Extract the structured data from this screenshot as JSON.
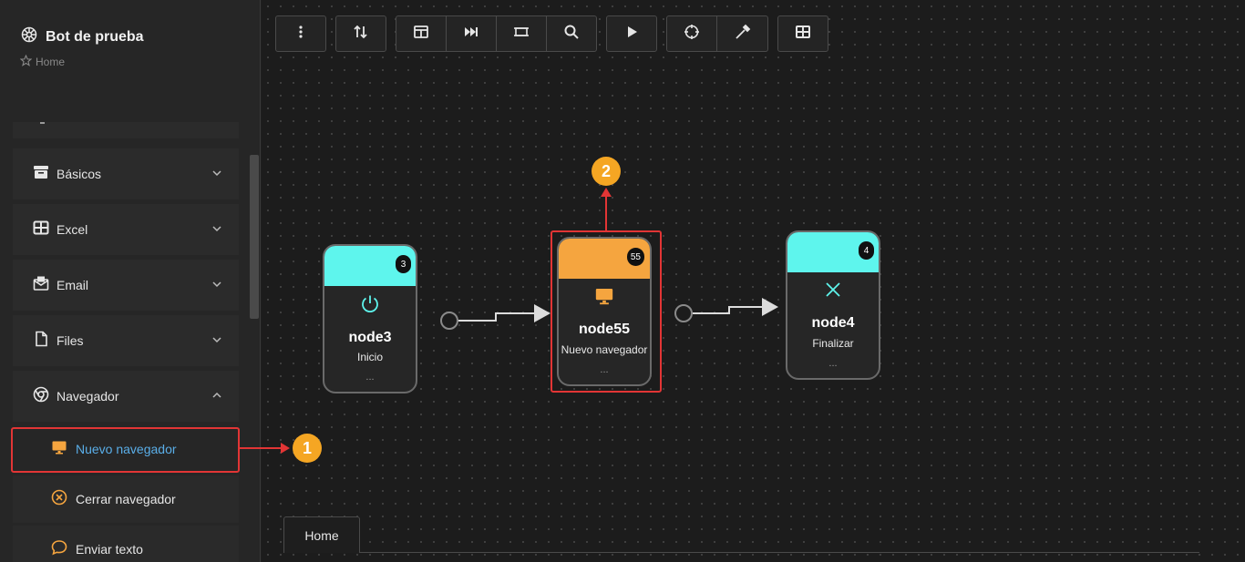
{
  "app": {
    "title": "Bot de prueba",
    "breadcrumb": "Home"
  },
  "sidebar": {
    "categories": [
      {
        "label": "Básicos",
        "icon": "archive-icon",
        "expanded": false
      },
      {
        "label": "Excel",
        "icon": "table-icon",
        "expanded": false
      },
      {
        "label": "Email",
        "icon": "mail-icon",
        "expanded": false
      },
      {
        "label": "Files",
        "icon": "file-icon",
        "expanded": false
      },
      {
        "label": "Navegador",
        "icon": "chrome-icon",
        "expanded": true
      }
    ],
    "navegador_items": [
      {
        "label": "Nuevo navegador",
        "icon": "monitor-icon",
        "selected": true
      },
      {
        "label": "Cerrar navegador",
        "icon": "close-circle-icon",
        "selected": false
      },
      {
        "label": "Enviar texto",
        "icon": "chat-bubble-icon",
        "selected": false
      }
    ]
  },
  "toolbar": {
    "buttons": [
      "more-vertical-icon",
      "sort-arrows-icon",
      "panel-icon",
      "skip-forward-icon",
      "swap-icon",
      "search-icon",
      "play-icon",
      "crosshair-icon",
      "eyedropper-icon",
      "grid-table-icon"
    ]
  },
  "nodes": [
    {
      "id": "node3",
      "badge": "3",
      "description": "Inicio",
      "footer": "...",
      "color": "#5ef5ed",
      "icon": "power-icon"
    },
    {
      "id": "node55",
      "badge": "55",
      "description": "Nuevo navegador",
      "footer": "...",
      "color": "#f5a53f",
      "icon": "monitor-icon"
    },
    {
      "id": "node4",
      "badge": "4",
      "description": "Finalizar",
      "footer": "...",
      "color": "#5ef5ed",
      "icon": "x-icon"
    }
  ],
  "tabs": [
    {
      "label": "Home",
      "active": true
    }
  ],
  "annotations": [
    {
      "number": "1"
    },
    {
      "number": "2"
    }
  ],
  "colors": {
    "accent_orange": "#f5a623",
    "highlight_red": "#e23535",
    "link_blue": "#5aaee8",
    "node_cyan": "#5ef5ed"
  }
}
